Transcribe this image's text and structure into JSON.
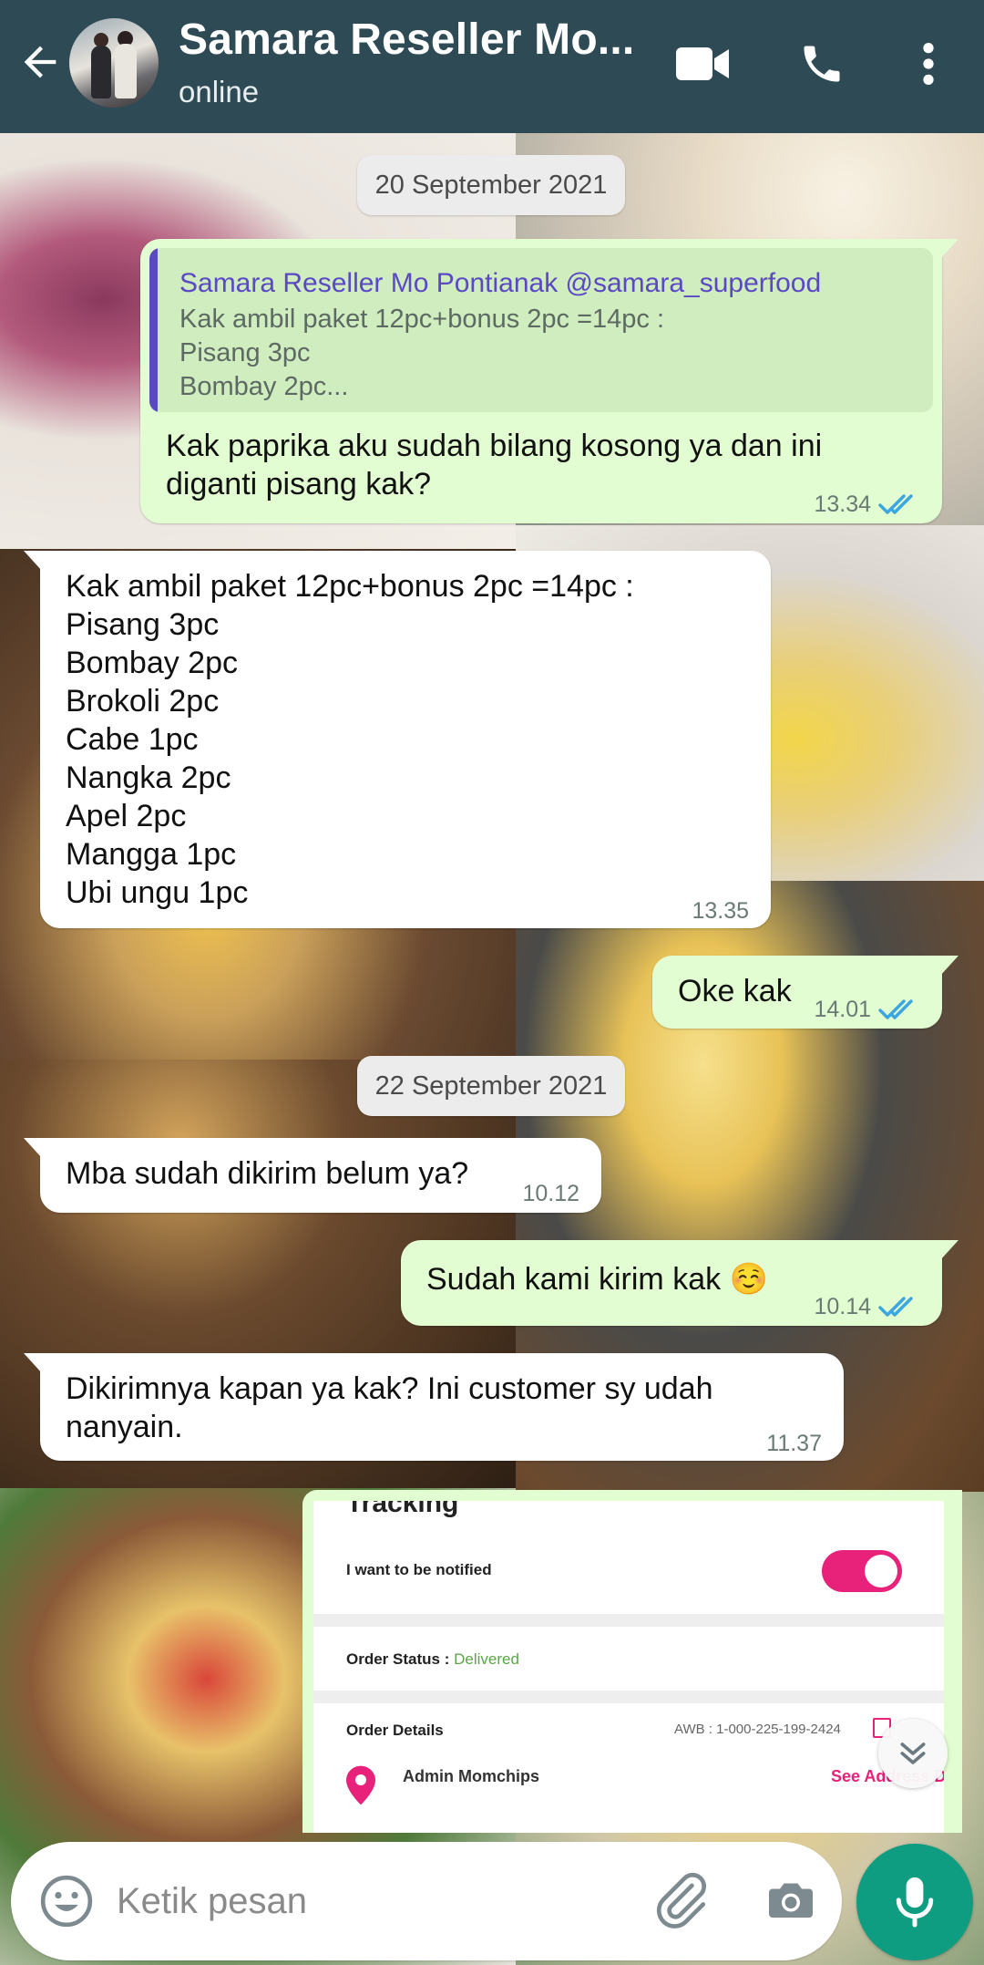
{
  "header": {
    "contact_name": "Samara Reseller Mo...",
    "status": "online"
  },
  "messages": {
    "date1": "20 September 2021",
    "m1": {
      "quote_author": "Samara Reseller Mo Pontianak @samara_superfood",
      "quote_text": "Kak ambil paket 12pc+bonus 2pc =14pc :\nPisang 3pc\nBombay 2pc...",
      "text": "Kak paprika aku sudah bilang kosong ya dan ini\ndiganti pisang kak?",
      "time": "13.34"
    },
    "m2": {
      "text": "Kak ambil paket 12pc+bonus 2pc =14pc :\nPisang 3pc\nBombay 2pc\nBrokoli 2pc\nCabe 1pc\nNangka 2pc\nApel 2pc\nMangga 1pc\nUbi ungu 1pc",
      "time": "13.35"
    },
    "m3": {
      "text": "Oke kak",
      "time": "14.01"
    },
    "date2": "22 September 2021",
    "m4": {
      "text": "Mba sudah dikirim belum ya?",
      "time": "10.12"
    },
    "m5": {
      "text": "Sudah kami kirim kak ☺️",
      "time": "10.14"
    },
    "m6": {
      "text": "Dikirimnya kapan ya kak? Ini customer sy udah\nnanyain.",
      "time": "11.37"
    }
  },
  "tracking_card": {
    "heading": "Tracking",
    "notify_label": "I want to be notified",
    "notify_enabled": true,
    "order_status_label": "Order Status :",
    "order_status_value": "Delivered",
    "order_details_label": "Order Details",
    "awb": "AWB :   1-000-225-199-2424",
    "recipient": "Admin Momchips",
    "see_address": "See Address Details"
  },
  "composer": {
    "placeholder": "Ketik pesan"
  },
  "colors": {
    "header_bg": "#2e4b55",
    "outgoing_bubble": "#e2fdd1",
    "incoming_bubble": "#ffffff",
    "read_ticks": "#3aa6e0",
    "mic_button": "#0f9d82",
    "quote_accent": "#5b49c4",
    "tracking_accent": "#e8227a"
  },
  "icons": [
    "back-arrow-icon",
    "video-call-icon",
    "voice-call-icon",
    "more-options-icon",
    "emoji-icon",
    "attach-icon",
    "camera-icon",
    "mic-icon",
    "double-check-icon",
    "scroll-down-icon",
    "location-pin-icon",
    "copy-icon"
  ]
}
